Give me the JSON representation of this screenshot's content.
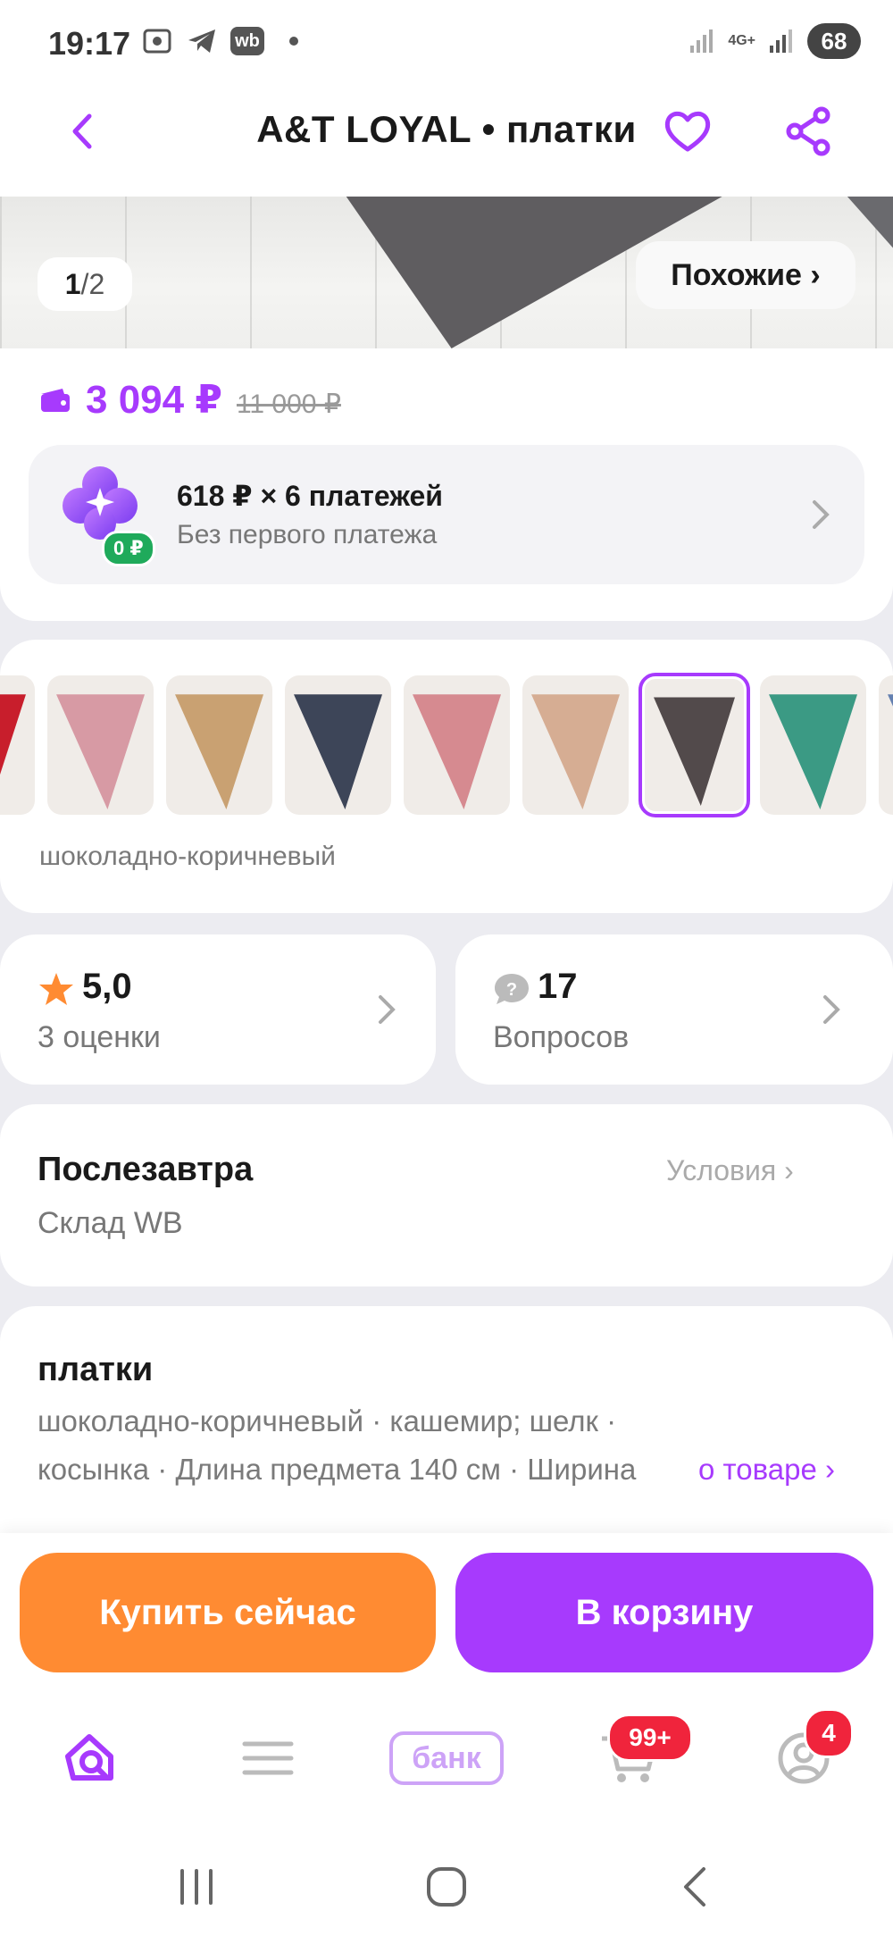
{
  "status_bar": {
    "time": "19:17",
    "wb_label": "wb",
    "network": "4G+",
    "battery": "68"
  },
  "header": {
    "title": "A&T LOYAL • платки"
  },
  "gallery": {
    "current": "1",
    "separator": "/",
    "total": "2",
    "similar_label": "Похожие ›"
  },
  "price": {
    "current": "3 094 ₽",
    "old": "11 000 ₽"
  },
  "installment": {
    "line1": "618 ₽ × 6 платежей",
    "line2": "Без первого платежа",
    "badge": "0 ₽"
  },
  "colors": {
    "selected_name": "шоколадно-коричневый",
    "swatches": [
      "#c81e2c",
      "#d79aa4",
      "#c9a172",
      "#3d4558",
      "#d68a90",
      "#d6ad93",
      "#524a4b",
      "#3b9a84",
      "#6480b0"
    ],
    "selected_index": 6
  },
  "rating": {
    "value": "5,0",
    "label": "3 оценки"
  },
  "questions": {
    "count": "17",
    "label": "Вопросов"
  },
  "delivery": {
    "when": "Послезавтра",
    "warehouse": "Склад WB",
    "conditions_label": "Условия ›"
  },
  "product_info": {
    "heading": "платки",
    "line1": "шоколадно-коричневый · кашемир; шелк ·",
    "line2": "косынка · Длина предмета 140 см · Ширина",
    "more_label": "о товаре ›"
  },
  "actions": {
    "buy_now": "Купить сейчас",
    "add_to_cart": "В корзину"
  },
  "bottom_nav": {
    "bank_label": "банк",
    "cart_badge": "99+",
    "profile_badge": "4"
  },
  "colors_accent": {
    "brand": "#a73afd",
    "orange": "#ff8b32"
  }
}
